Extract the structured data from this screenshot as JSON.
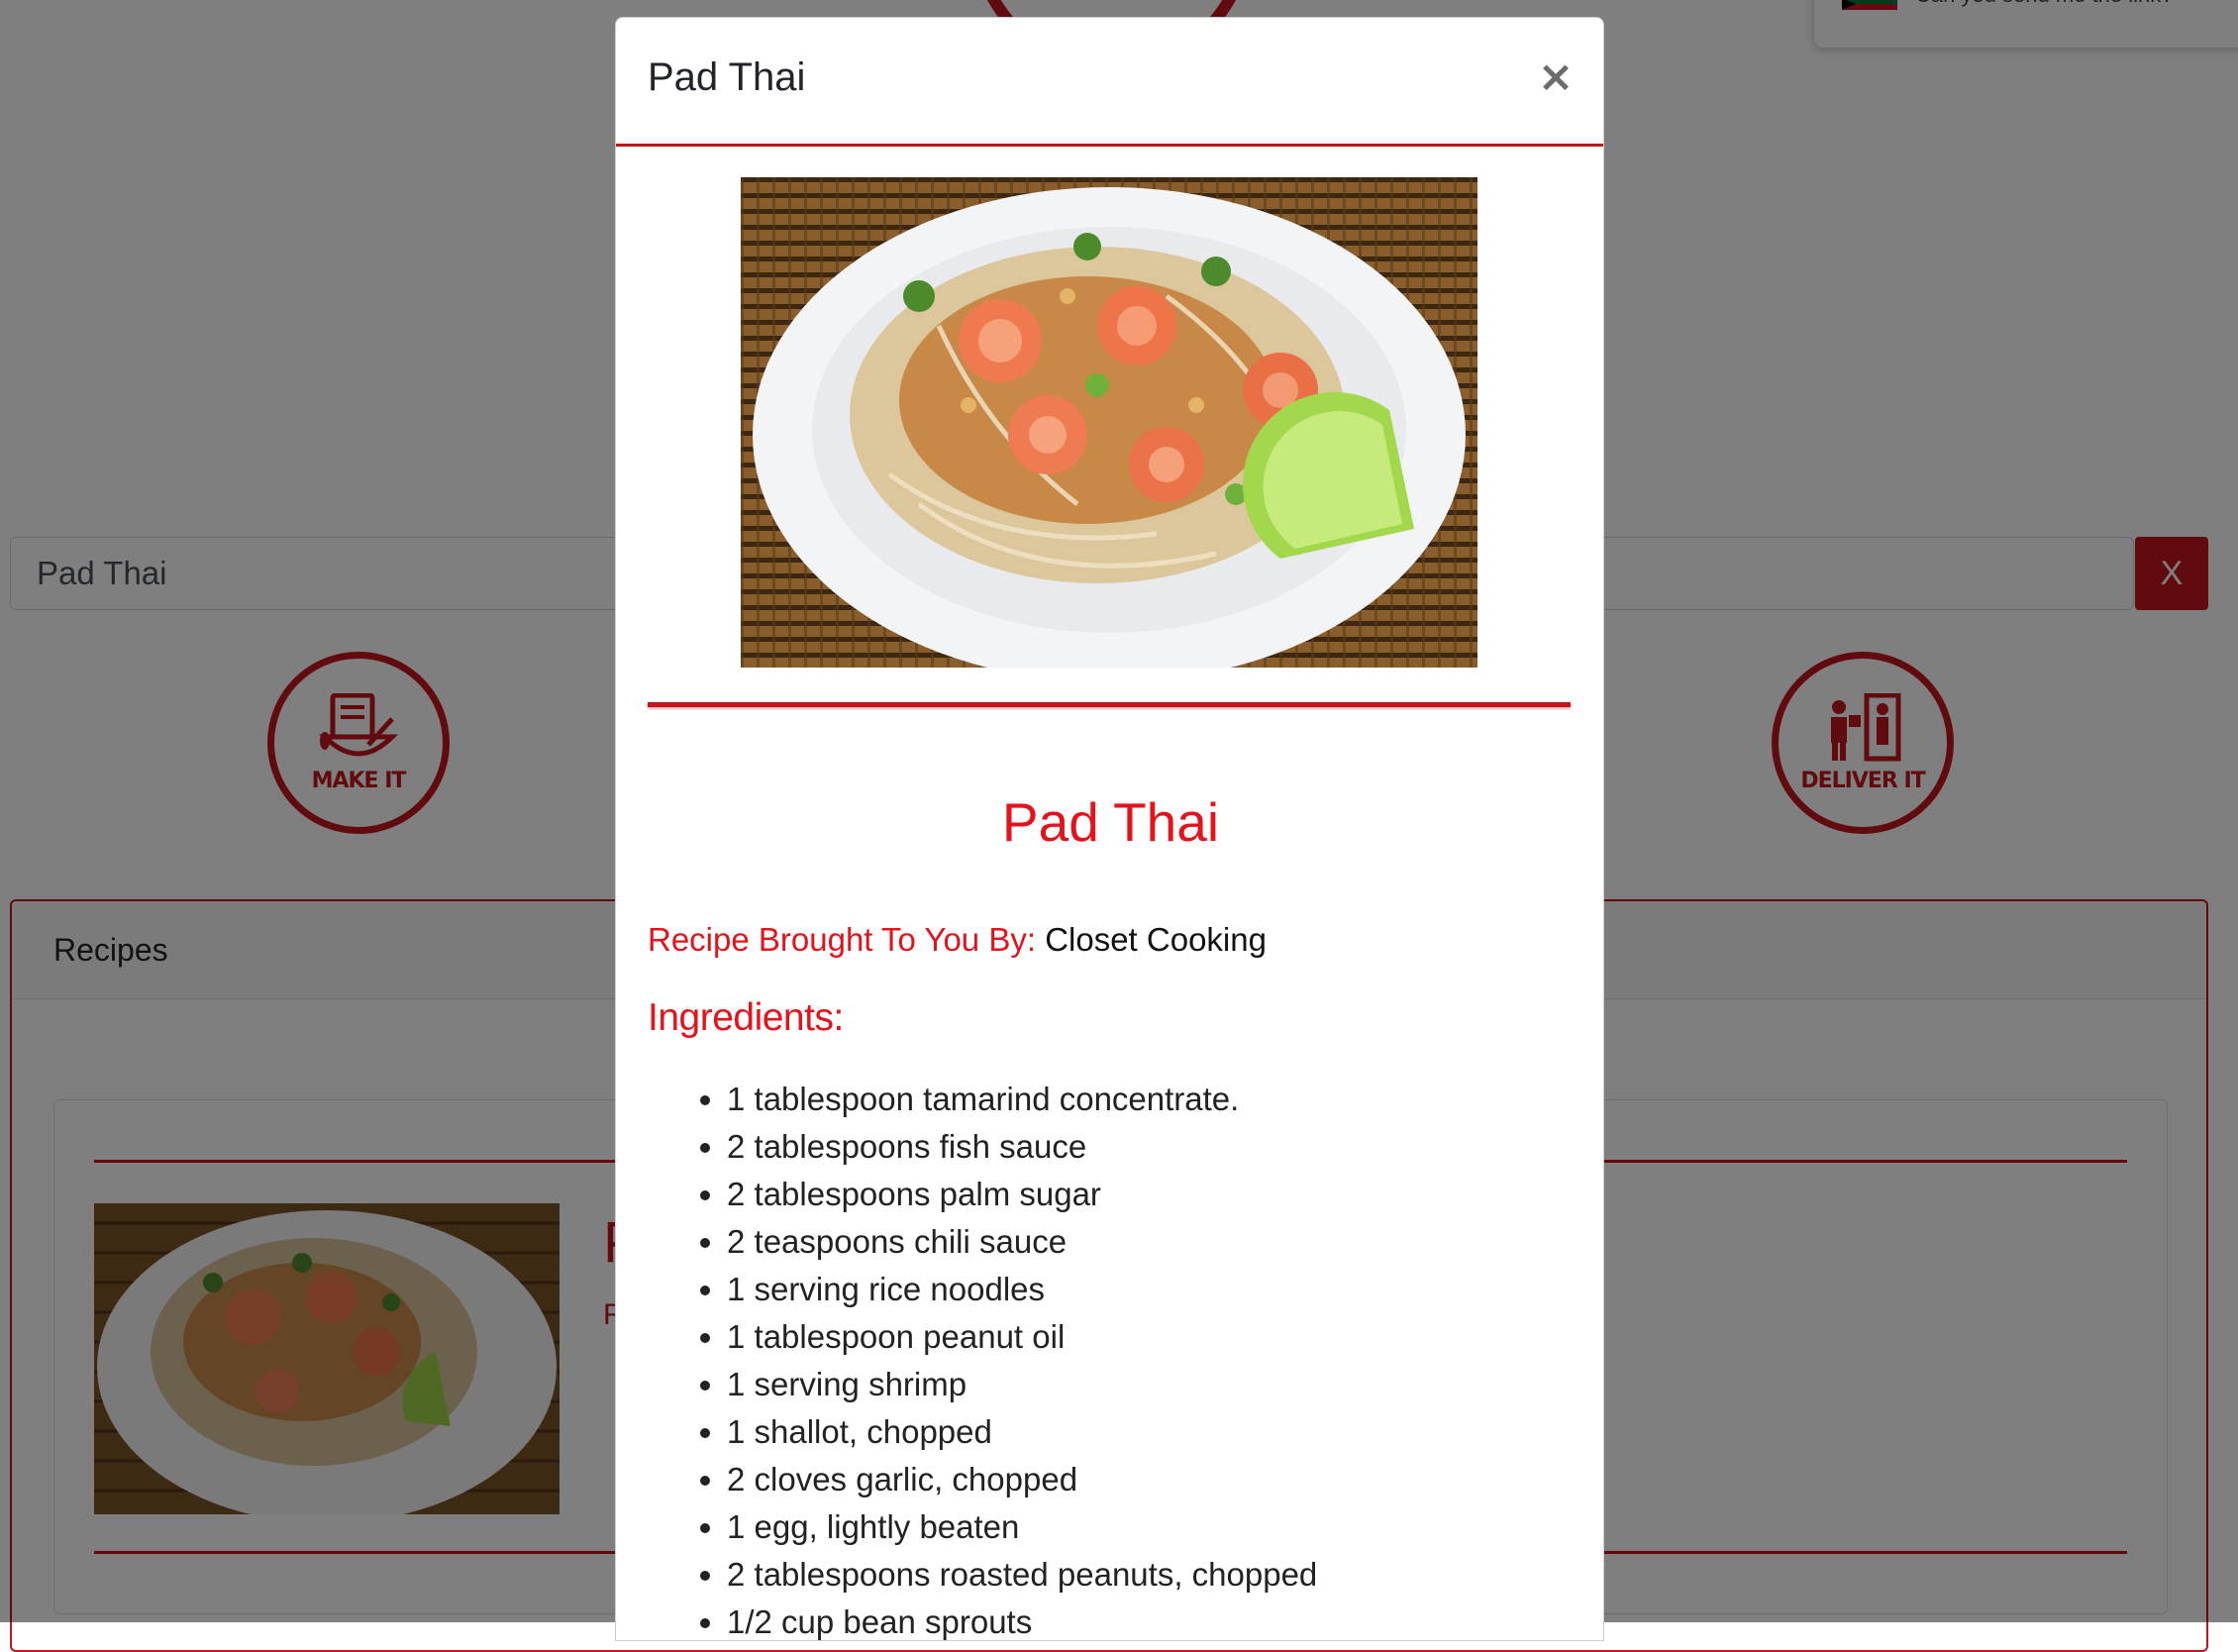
{
  "search": {
    "value": "Pad Thai",
    "clear_label": "X"
  },
  "actions": {
    "make_label": "MAKE IT",
    "deliver_label": "DELIVER IT"
  },
  "recipes_panel": {
    "heading": "Recipes",
    "card": {
      "title_partial": "P",
      "subtitle_partial": "Re"
    }
  },
  "chat": {
    "message": "Can you send me the link?"
  },
  "modal": {
    "header_title": "Pad Thai",
    "close_label": "×",
    "recipe_title": "Pad Thai",
    "credit_label": "Recipe Brought To You By:",
    "credit_value": "Closet Cooking",
    "ingredients_heading": "Ingredients:",
    "ingredients": [
      "1 tablespoon tamarind concentrate.",
      "2 tablespoons fish sauce",
      "2 tablespoons palm sugar",
      "2 teaspoons chili sauce",
      "1 serving rice noodles",
      "1 tablespoon peanut oil",
      "1 serving shrimp",
      "1 shallot, chopped",
      "2 cloves garlic, chopped",
      "1 egg, lightly beaten",
      "2 tablespoons roasted peanuts, chopped",
      "1/2 cup bean sprouts"
    ]
  },
  "colors": {
    "brand_red": "#c3161c",
    "title_red": "#e5121b",
    "overlay": "rgba(0,0,0,0.5)"
  }
}
